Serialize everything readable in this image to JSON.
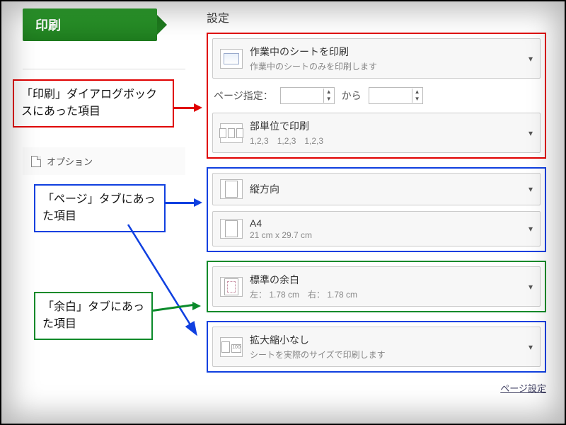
{
  "sidebar": {
    "print_tab": "印刷",
    "options": "オプション"
  },
  "settings": {
    "title": "設定",
    "print_active": {
      "title": "作業中のシートを印刷",
      "sub": "作業中のシートのみを印刷します"
    },
    "page_range": {
      "label": "ページ指定：",
      "sep": "から"
    },
    "collate": {
      "title": "部単位で印刷",
      "sub": "1,2,3　1,2,3　1,2,3"
    },
    "orientation": {
      "title": "縦方向"
    },
    "paper": {
      "title": "A4",
      "sub": "21 cm x 29.7 cm"
    },
    "margins": {
      "title": "標準の余白",
      "sub": "左： 1.78 cm　右： 1.78 cm"
    },
    "scaling": {
      "title": "拡大縮小なし",
      "sub": "シートを実際のサイズで印刷します"
    },
    "page_setup_link": "ページ設定"
  },
  "callouts": {
    "c1": "「印刷」ダイアログボックスにあった項目",
    "c2": "「ページ」タブにあった項目",
    "c3": "「余白」タブにあった項目"
  }
}
